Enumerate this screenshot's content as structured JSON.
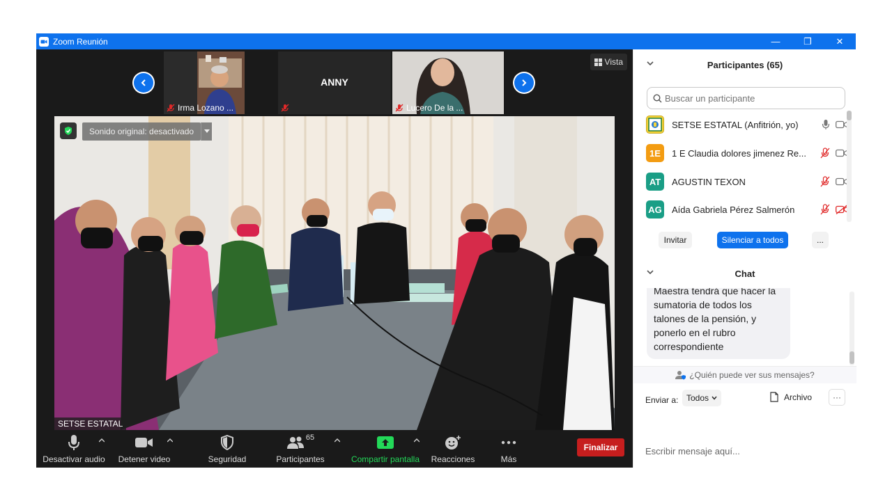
{
  "window": {
    "title": "Zoom Reunión",
    "controls": {
      "minimize": "—",
      "restore": "❐",
      "close": "✕"
    }
  },
  "strip": {
    "tiles": [
      {
        "name": "Irma Lozano ...",
        "muted": true
      },
      {
        "name": "ANNY",
        "muted": true
      },
      {
        "name": "Lucero De la ...",
        "muted": true
      }
    ],
    "view_label": "Vista"
  },
  "main_video": {
    "sound_label": "Sonido original: desactivado",
    "speaker_name": "SETSE ESTATAL"
  },
  "toolbar": {
    "mute_label": "Desactivar audio",
    "video_label": "Detener video",
    "security_label": "Seguridad",
    "participants_label": "Participantes",
    "participants_count": "65",
    "share_label": "Compartir pantalla",
    "reactions_label": "Reacciones",
    "more_label": "Más",
    "end_label": "Finalizar"
  },
  "participants_panel": {
    "title": "Participantes (65)",
    "search_placeholder": "Buscar un participante",
    "list": [
      {
        "initials": "",
        "name": "SETSE ESTATAL (Anfitrión, yo)",
        "color": "#f5d33a",
        "muted": false,
        "video_off": false
      },
      {
        "initials": "1E",
        "name": "1 E Claudia dolores jimenez Re...",
        "color": "#f39c12",
        "muted": true,
        "video_off": false
      },
      {
        "initials": "AT",
        "name": "AGUSTIN TEXON",
        "color": "#1a9e86",
        "muted": true,
        "video_off": false
      },
      {
        "initials": "AG",
        "name": "Aída Gabriela Pérez Salmerón",
        "color": "#1a9e86",
        "muted": true,
        "video_off": true
      }
    ],
    "invite_label": "Invitar",
    "mute_all_label": "Silenciar a todos",
    "more_label": "..."
  },
  "chat_panel": {
    "title": "Chat",
    "message": "Maestra tendrá que hacer la sumatoria de todos los talones de la pensión, y ponerlo en el rubro correspondiente",
    "who_sees": "¿Quién puede ver sus mensajes?",
    "send_to_label": "Enviar a:",
    "send_to_value": "Todos",
    "file_label": "Archivo",
    "more_label": "···",
    "input_placeholder": "Escribir mensaje aquí..."
  }
}
